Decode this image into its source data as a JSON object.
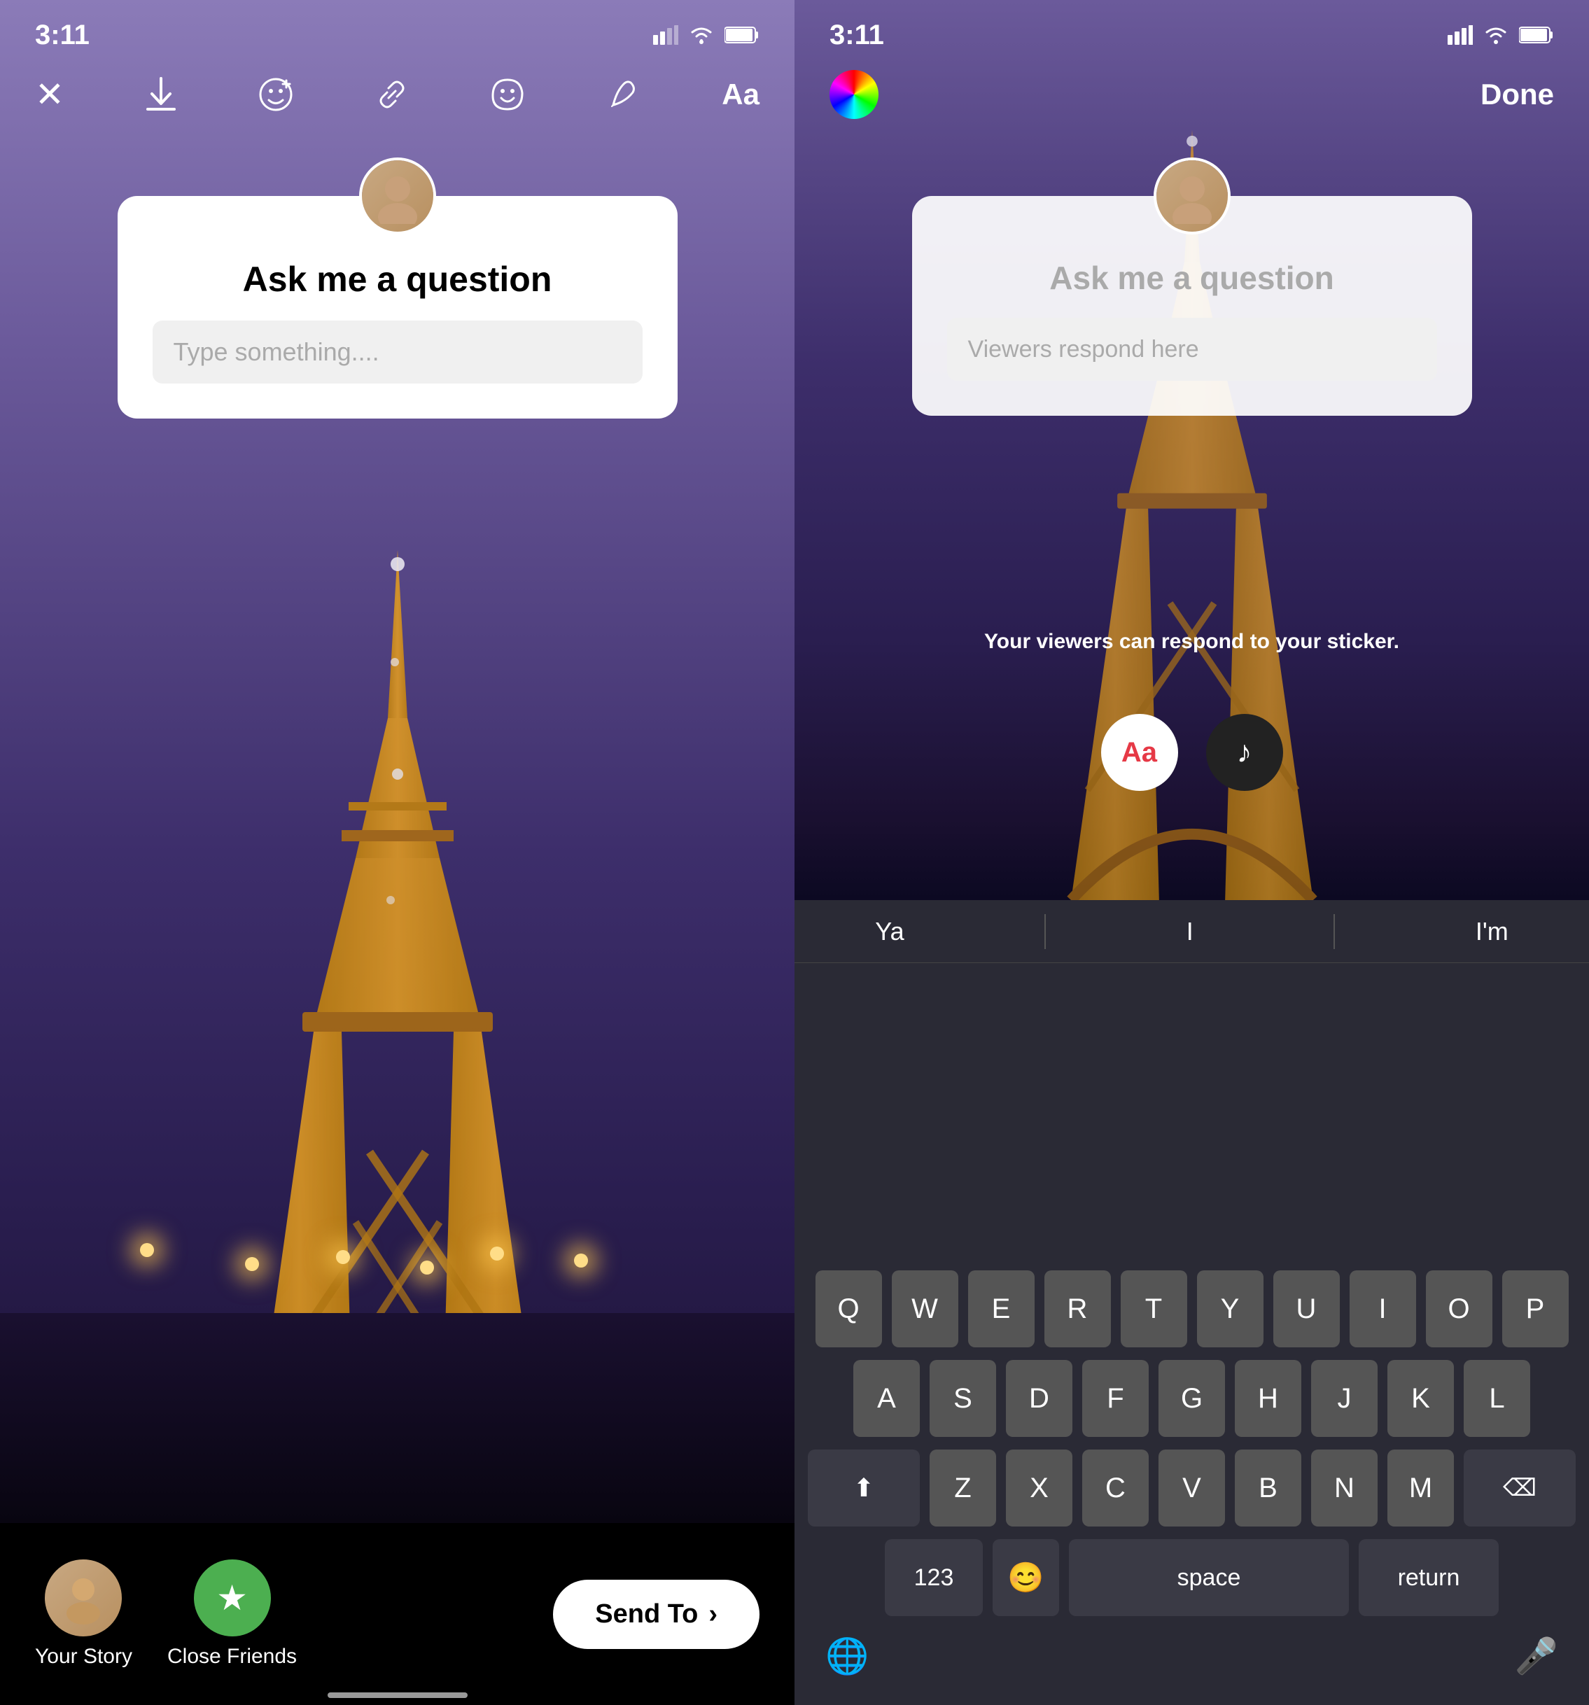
{
  "left_phone": {
    "status": {
      "time": "3:11",
      "signal": "▌▌",
      "wifi": "wifi",
      "battery": "battery"
    },
    "toolbar": {
      "close": "✕",
      "download": "⬇",
      "emoji_add": "😊+",
      "link": "🔗",
      "sticker": "😀",
      "draw": "✏",
      "text": "Aa"
    },
    "sticker": {
      "question_title": "Ask me a question",
      "input_placeholder": "Type something...."
    },
    "share_bar": {
      "your_story_label": "Your Story",
      "close_friends_label": "Close Friends",
      "send_to_label": "Send To"
    }
  },
  "right_phone": {
    "status": {
      "time": "3:11"
    },
    "toolbar": {
      "done_label": "Done"
    },
    "sticker": {
      "question_title": "Ask me a question",
      "viewers_placeholder": "Viewers respond here",
      "info_text": "Your viewers can respond to your sticker."
    },
    "tools": {
      "text_label": "Aa",
      "music_label": "♪"
    },
    "autocomplete": {
      "items": [
        "Ya",
        "I",
        "I'm"
      ]
    },
    "keyboard": {
      "row1": [
        "Q",
        "W",
        "E",
        "R",
        "T",
        "Y",
        "U",
        "I",
        "O",
        "P"
      ],
      "row2": [
        "A",
        "S",
        "D",
        "F",
        "G",
        "H",
        "J",
        "K",
        "L"
      ],
      "row3": [
        "Z",
        "X",
        "C",
        "V",
        "B",
        "N",
        "M"
      ],
      "bottom": {
        "numbers": "123",
        "emoji": "😊",
        "space": "space",
        "return": "return"
      }
    }
  }
}
